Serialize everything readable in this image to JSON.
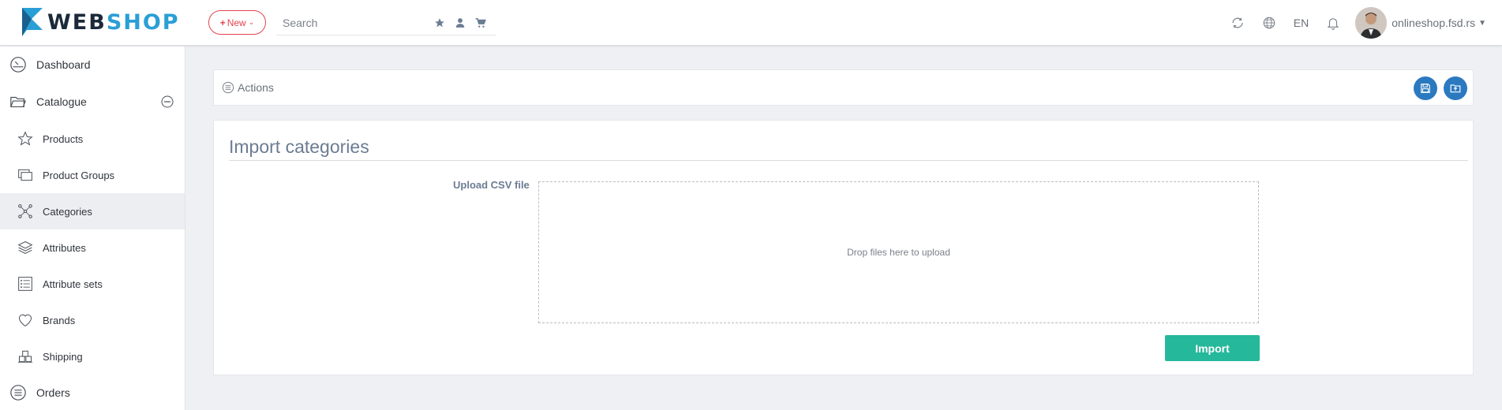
{
  "brand": {
    "part1": "WEB",
    "part2": "SHOP",
    "accent": "#2a9fd6",
    "dark": "#1b2a3a"
  },
  "topbar": {
    "new_label": "New",
    "search_placeholder": "Search",
    "search_icons": [
      "star-icon",
      "user-icon",
      "cart-icon"
    ],
    "tools": [
      "refresh-icon",
      "globe-icon"
    ],
    "language": "EN",
    "notification_icon": "bell-icon",
    "shop_name": "onlineshop.fsd.rs"
  },
  "sidebar": {
    "items": [
      {
        "label": "Dashboard",
        "icon": "dashboard-icon",
        "level": "top"
      },
      {
        "label": "Catalogue",
        "icon": "folder-icon",
        "level": "top",
        "expanded": true
      },
      {
        "label": "Products",
        "icon": "star-outline-icon",
        "level": "sub"
      },
      {
        "label": "Product Groups",
        "icon": "stacked-windows-icon",
        "level": "sub"
      },
      {
        "label": "Categories",
        "icon": "network-icon",
        "level": "sub",
        "active": true
      },
      {
        "label": "Attributes",
        "icon": "layers-icon",
        "level": "sub"
      },
      {
        "label": "Attribute sets",
        "icon": "checklist-icon",
        "level": "sub"
      },
      {
        "label": "Brands",
        "icon": "heart-icon",
        "level": "sub"
      },
      {
        "label": "Shipping",
        "icon": "boxes-icon",
        "level": "sub"
      },
      {
        "label": "Orders",
        "icon": "list-circle-icon",
        "level": "top"
      }
    ]
  },
  "actions": {
    "label": "Actions",
    "buttons": [
      "save-icon",
      "folder-upload-icon"
    ],
    "button_color": "#2b7ac0"
  },
  "main": {
    "title": "Import categories",
    "upload_label": "Upload CSV file",
    "dropzone_text": "Drop files here to upload",
    "import_label": "Import",
    "import_color": "#26b89a"
  }
}
